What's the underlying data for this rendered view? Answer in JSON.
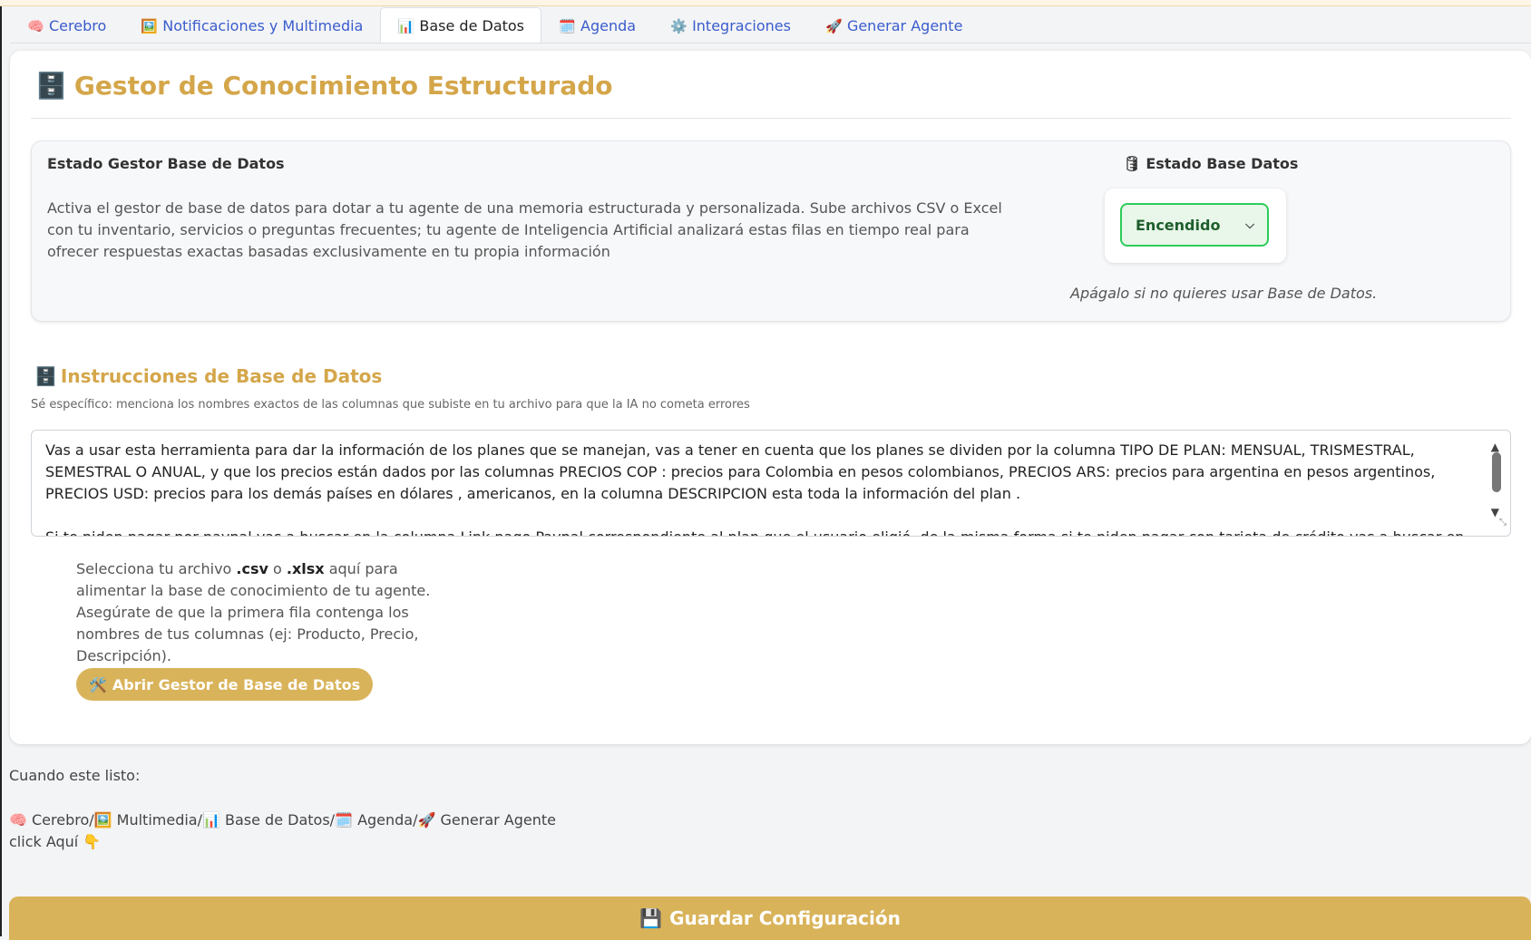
{
  "tabs": [
    {
      "icon": "🧠",
      "label": "Cerebro"
    },
    {
      "icon": "🖼️",
      "label": "Notificaciones y Multimedia"
    },
    {
      "icon": "📊",
      "label": "Base de Datos"
    },
    {
      "icon": "🗓️",
      "label": "Agenda"
    },
    {
      "icon": "⚙️",
      "label": "Integraciones"
    },
    {
      "icon": "🚀",
      "label": "Generar Agente"
    }
  ],
  "active_tab": "Base de Datos",
  "page": {
    "title_icon": "🗄️",
    "title": "Gestor de Conocimiento Estructurado"
  },
  "status": {
    "heading": "Estado Gestor Base de Datos",
    "description": "Activa el gestor de base de datos para dotar a tu agente de una memoria estructurada y personalizada. Sube archivos CSV o Excel con tu inventario, servicios o preguntas frecuentes; tu agente de Inteligencia Artificial analizará estas filas en tiempo real para ofrecer respuestas exactas basadas exclusivamente en tu propia información",
    "db_label_icon": "🛢",
    "db_label": "Estado Base Datos",
    "select_value": "Encendido",
    "hint": "Apágalo si no quieres usar Base de Datos."
  },
  "instructions": {
    "title_icon": "🗄️",
    "title": "Instrucciones de Base de Datos",
    "subtitle": "Sé específico: menciona los nombres exactos de las columnas que subiste en tu archivo para que la IA no cometa errores",
    "paragraph1": "Vas a usar esta herramienta para dar la información de los planes que se manejan, vas a tener en cuenta que los planes se dividen por la columna TIPO DE PLAN: MENSUAL, TRISMESTRAL, SEMESTRAL O ANUAL, y que los precios están dados por las columnas PRECIOS COP : precios para Colombia en pesos colombianos, PRECIOS ARS: precios para argentina en pesos argentinos, PRECIOS USD: precios para los demás países en dólares , americanos, en  la columna DESCRIPCION esta toda la información del plan .",
    "paragraph2": "Si te piden pagar por paypal vas a buscar en la columna Link pago Paypal correspondiente al plan que el usuario eligió, de la misma forma si te piden pagar con tarjeta de crédito vas a buscar en la columna Kink Pago Bold"
  },
  "upload": {
    "text_a": "Selecciona tu archivo ",
    "csv": ".csv",
    "text_b": " o ",
    "xlsx": ".xlsx",
    "text_c": " aquí para alimentar la base de conocimiento de tu agente. Asegúrate de que la primera fila contenga los nombres de tus columnas (ej: Producto, Precio, Descripción).",
    "button_icon": "🛠️",
    "button_label": "Abrir Gestor de Base de Datos"
  },
  "footer": {
    "when_ready": "Cuando este listo:",
    "path": "🧠 Cerebro/🖼️ Multimedia/📊 Base de Datos/🗓️ Agenda/🚀 Generar Agente",
    "click_here": "click Aquí 👇"
  },
  "save": {
    "icon": "💾",
    "label": "Guardar Configuración"
  }
}
